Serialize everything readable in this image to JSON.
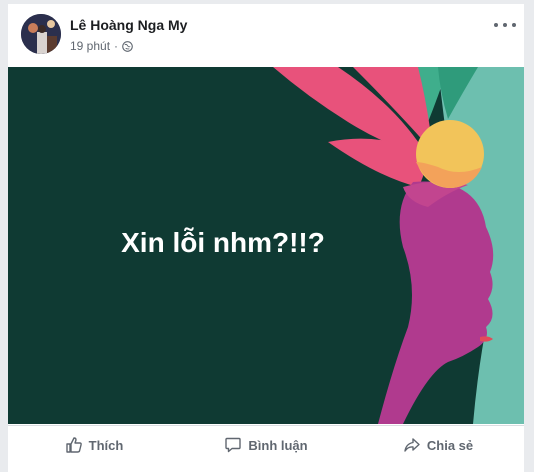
{
  "post": {
    "author": "Lê Hoàng Nga My",
    "time": "19 phút",
    "separator": "·",
    "privacy_icon": "globe-icon",
    "more_icon": "more-options-icon",
    "content_text": "Xin lỗi nhm?!!?",
    "banner_colors": {
      "background": "#0f3a33",
      "teal": "#6dbfaf",
      "pink": "#e8527b",
      "magenta": "#b03a8e",
      "yellow": "#f2c45a",
      "orange": "#f3a25a",
      "green": "#3fae8c"
    }
  },
  "actions": {
    "like_label": "Thích",
    "comment_label": "Bình luận",
    "share_label": "Chia sẻ",
    "like_icon": "thumbs-up-icon",
    "comment_icon": "comment-icon",
    "share_icon": "share-icon"
  }
}
